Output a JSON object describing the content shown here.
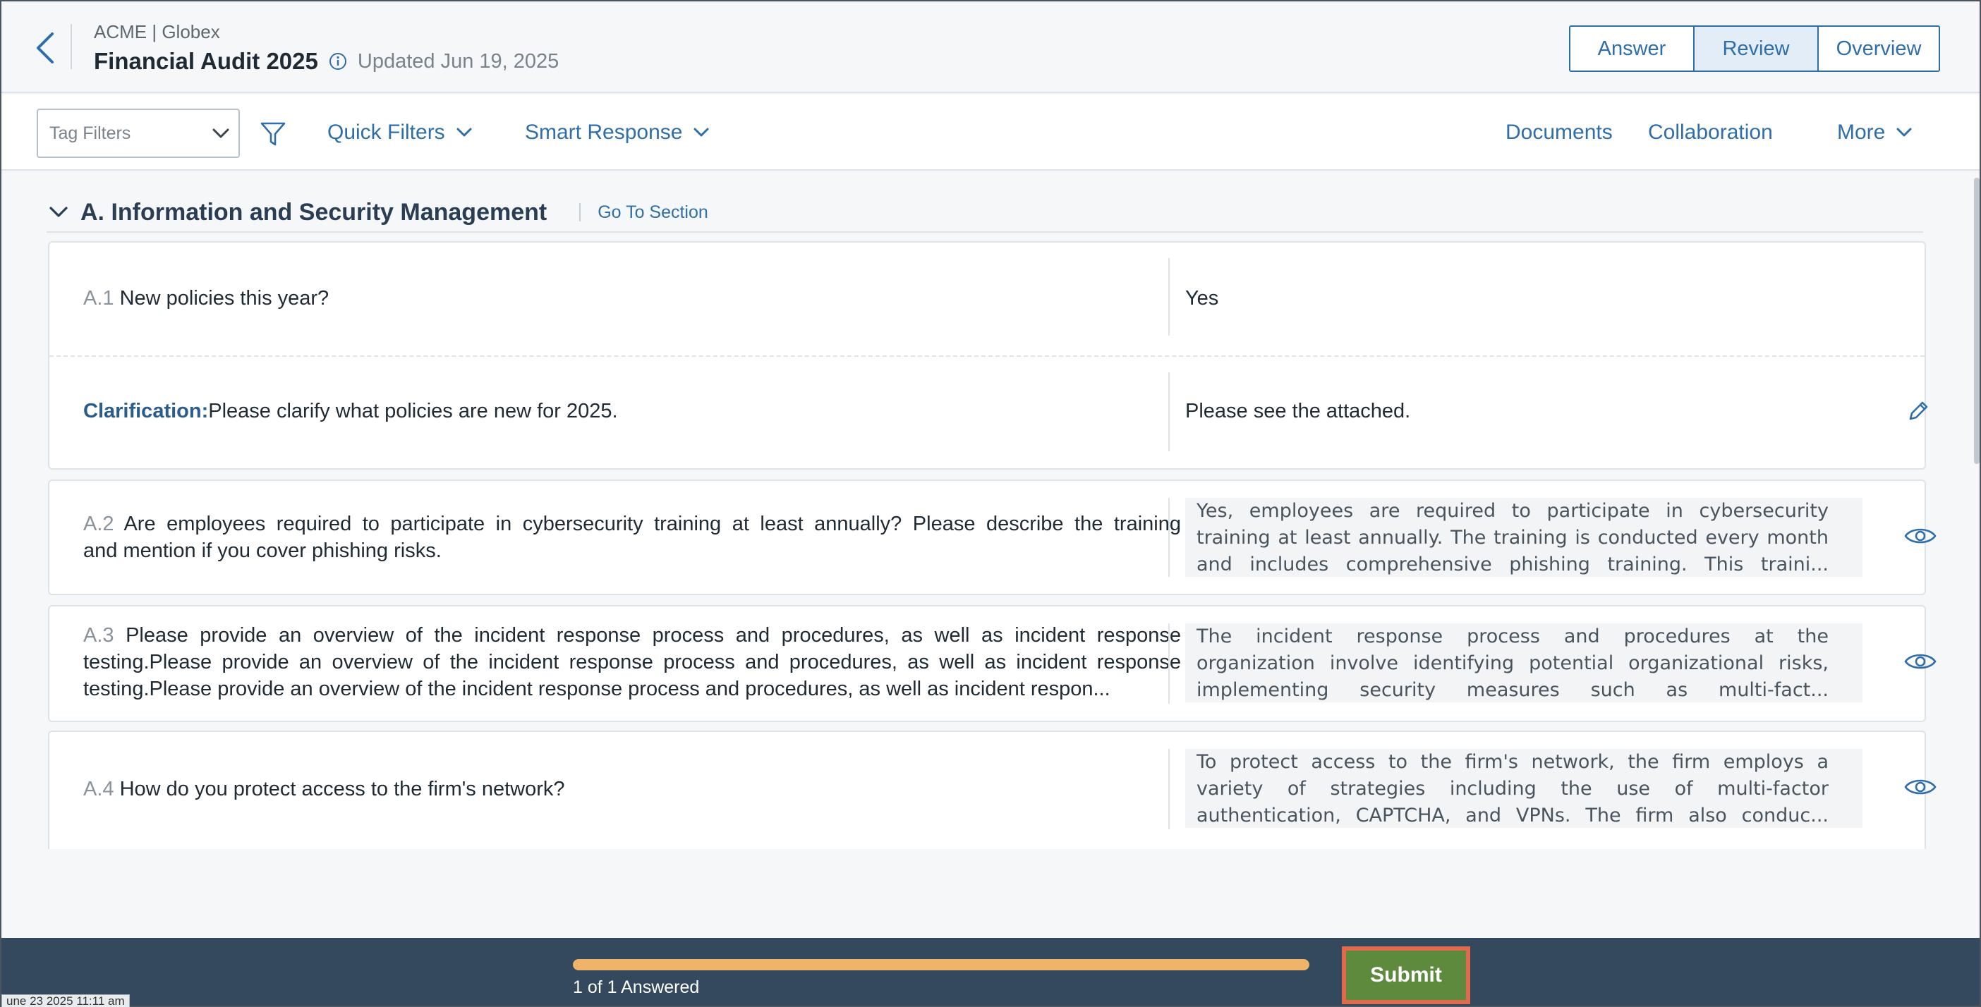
{
  "header": {
    "org": "ACME | Globex",
    "title": "Financial Audit 2025",
    "updated": "Updated Jun 19, 2025",
    "tabs": [
      {
        "label": "Answer",
        "active": false
      },
      {
        "label": "Review",
        "active": true
      },
      {
        "label": "Overview",
        "active": false
      }
    ]
  },
  "toolbar": {
    "tag_filters_placeholder": "Tag Filters",
    "quick_filters": "Quick Filters",
    "smart_response": "Smart Response",
    "documents": "Documents",
    "collaboration": "Collaboration",
    "more": "More"
  },
  "section": {
    "title": "A. Information and Security Management",
    "goto": "Go To Section"
  },
  "questions": [
    {
      "num": "A.1",
      "text": "New policies this year?",
      "answer": "Yes",
      "clarification": {
        "label": "Clarification:",
        "text": "Please clarify what policies are new for 2025.",
        "answer": "Please see the attached."
      }
    },
    {
      "num": "A.2",
      "text_lines": [
        "Are employees required to participate in cybersecurity training at least annually? Please describe the training",
        "and mention if you cover phishing risks."
      ],
      "answer_lines": [
        "Yes, employees are required to participate in cybersecurity",
        "training at least annually. The training is conducted every month",
        "and includes comprehensive phishing training. This traini..."
      ]
    },
    {
      "num": "A.3",
      "text_lines": [
        "Please provide an overview of the incident response process and procedures, as well as incident response",
        "testing.Please provide an overview of the incident response process and procedures, as well as incident response",
        "testing.Please provide an overview of the incident response process and procedures, as well as incident respon..."
      ],
      "answer_lines": [
        "The incident response process and procedures at the",
        "organization involve identifying potential organizational risks,",
        "implementing security measures such as multi-fact..."
      ]
    },
    {
      "num": "A.4",
      "text": "How do you protect access to the firm's network?",
      "answer_lines": [
        "To protect access to the firm's network, the firm employs a",
        "variety of strategies including the use of multi-factor",
        "authentication, CAPTCHA, and VPNs. The firm also conduc..."
      ]
    }
  ],
  "footer": {
    "progress_label": "1 of 1 Answered",
    "progress_fraction": 1.0,
    "submit": "Submit",
    "timestamp": "une 23 2025 11:11 am"
  },
  "colors": {
    "accent": "#2f6ea8",
    "footer_bg": "#34495e",
    "progress": "#f0b36a",
    "submit": "#5e8a3e",
    "submit_highlight": "#e06a4e"
  },
  "icons": {
    "back": "chevron-left-icon",
    "info": "info-circle-icon",
    "filter": "funnel-icon",
    "edit": "pencil-icon",
    "view": "eye-icon"
  }
}
